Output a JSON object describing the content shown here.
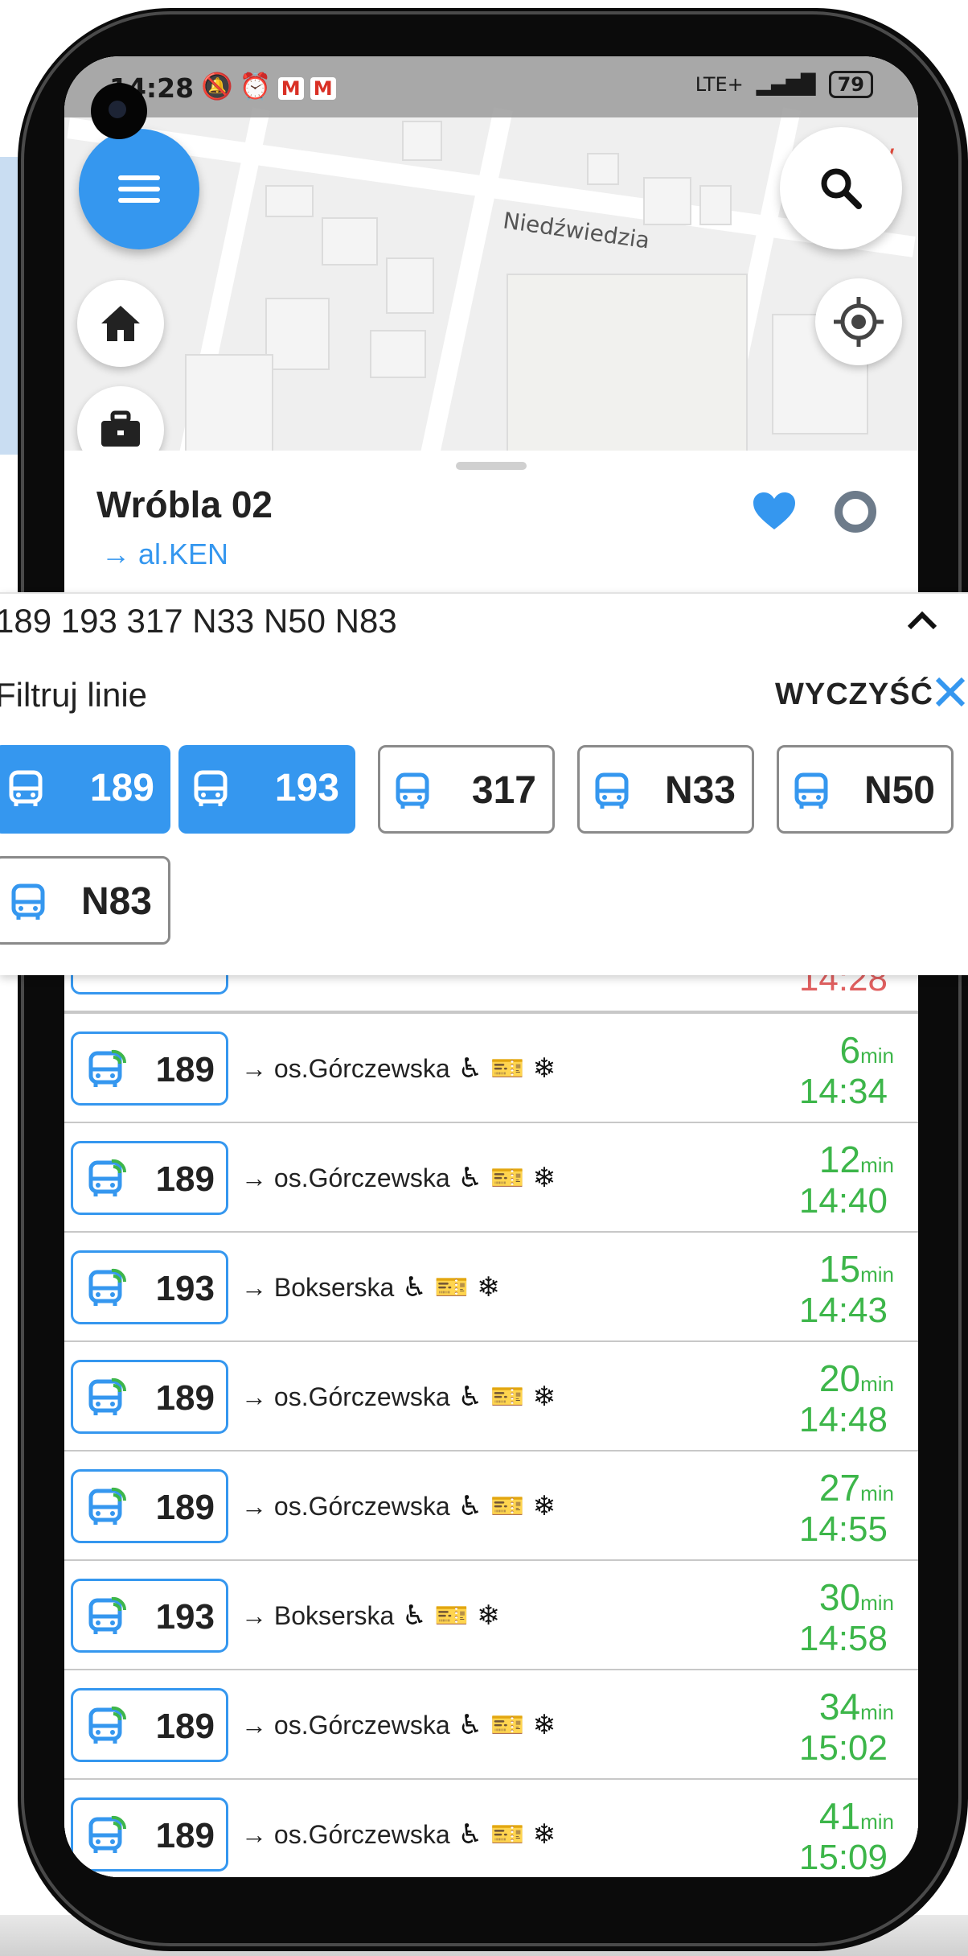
{
  "status_bar": {
    "time": "14:28",
    "network": "LTE+",
    "battery": "79"
  },
  "map": {
    "street_label": "Niedźwiedzia",
    "corner_letter": "W"
  },
  "stop": {
    "name": "Wróbla 02",
    "direction": "al.KEN"
  },
  "filter": {
    "lines_summary": "189 193 317 N33 N50 N83",
    "label": "Filtruj linie",
    "clear_label": "WYCZYŚĆ",
    "chips": [
      {
        "line": "189",
        "selected": true
      },
      {
        "line": "193",
        "selected": true
      },
      {
        "line": "317",
        "selected": false
      },
      {
        "line": "N33",
        "selected": false
      },
      {
        "line": "N50",
        "selected": false
      },
      {
        "line": "N83",
        "selected": false
      }
    ]
  },
  "partial_departure_time": "14:28",
  "departures": [
    {
      "line": "189",
      "destination": "os.Górczewska",
      "minutes": "6",
      "unit": "min",
      "time": "14:34"
    },
    {
      "line": "189",
      "destination": "os.Górczewska",
      "minutes": "12",
      "unit": "min",
      "time": "14:40"
    },
    {
      "line": "193",
      "destination": "Bokserska",
      "minutes": "15",
      "unit": "min",
      "time": "14:43"
    },
    {
      "line": "189",
      "destination": "os.Górczewska",
      "minutes": "20",
      "unit": "min",
      "time": "14:48"
    },
    {
      "line": "189",
      "destination": "os.Górczewska",
      "minutes": "27",
      "unit": "min",
      "time": "14:55"
    },
    {
      "line": "193",
      "destination": "Bokserska",
      "minutes": "30",
      "unit": "min",
      "time": "14:58"
    },
    {
      "line": "189",
      "destination": "os.Górczewska",
      "minutes": "34",
      "unit": "min",
      "time": "15:02"
    },
    {
      "line": "189",
      "destination": "os.Górczewska",
      "minutes": "41",
      "unit": "min",
      "time": "15:09"
    }
  ],
  "icons": {
    "menu": "hamburger-icon",
    "home": "home-icon",
    "work": "briefcase-icon",
    "search": "search-icon",
    "locate": "crosshair-icon",
    "favorite": "heart-icon",
    "bus": "bus-icon",
    "realtime_bus": "bus-realtime-icon",
    "wheelchair": "wheelchair-icon",
    "ticket_machine": "ticket-machine-icon",
    "air_conditioning": "snowflake-icon"
  },
  "colors": {
    "accent": "#3597ef",
    "realtime_green": "#3db64a",
    "late_red": "#e06060"
  }
}
